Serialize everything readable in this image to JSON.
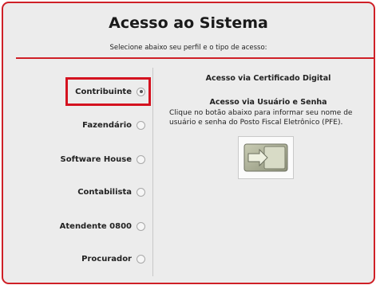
{
  "header": {
    "title": "Acesso ao Sistema",
    "subtitle": "Selecione abaixo seu perfil e o tipo de acesso:"
  },
  "profiles": [
    {
      "label": "Contribuinte",
      "selected": true
    },
    {
      "label": "Fazendário",
      "selected": false
    },
    {
      "label": "Software House",
      "selected": false
    },
    {
      "label": "Contabilista",
      "selected": false
    },
    {
      "label": "Atendente 0800",
      "selected": false
    },
    {
      "label": "Procurador",
      "selected": false
    }
  ],
  "access": {
    "certificate_title": "Acesso via Certificado Digital",
    "user_title": "Acesso via Usuário e Senha",
    "user_description": "Clique no botão abaixo para informar seu nome de usuário e senha do Posto Fiscal Eletrônico (PFE).",
    "login_button_icon": "login-arrow-icon"
  },
  "colors": {
    "accent": "#cf2027",
    "panel_bg": "#ececec"
  }
}
